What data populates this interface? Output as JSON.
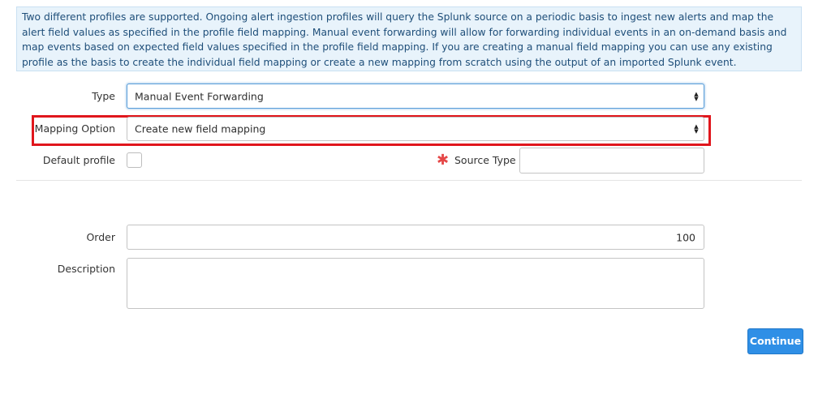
{
  "info_text": "Two different profiles are supported. Ongoing alert ingestion profiles will query the Splunk source on a periodic basis to ingest new alerts and map the alert field values as specified in the profile field mapping. Manual event forwarding will allow for forwarding individual events in an on-demand basis and map events based on expected field values specified in the profile field mapping. If you are creating a manual field mapping you can use any existing profile as the basis to create the individual field mapping or create a new mapping from scratch using the output of an imported Splunk event.",
  "form": {
    "type_label": "Type",
    "type_value": "Manual Event Forwarding",
    "mapping_option_label": "Mapping Option",
    "mapping_option_value": "Create new field mapping",
    "default_profile_label": "Default profile",
    "default_profile_checked": false,
    "source_type_label": "Source Type",
    "source_type_value": "",
    "order_label": "Order",
    "order_value": "100",
    "description_label": "Description",
    "description_value": ""
  },
  "continue_label": "Continue",
  "icons": {
    "select_arrows": "updown-arrows-icon",
    "required": "asterisk-icon"
  },
  "colors": {
    "info_bg": "#e8f3fb",
    "info_text": "#1e4e79",
    "highlight": "#e0161c",
    "button": "#2f8fe6",
    "required": "#e54848"
  }
}
